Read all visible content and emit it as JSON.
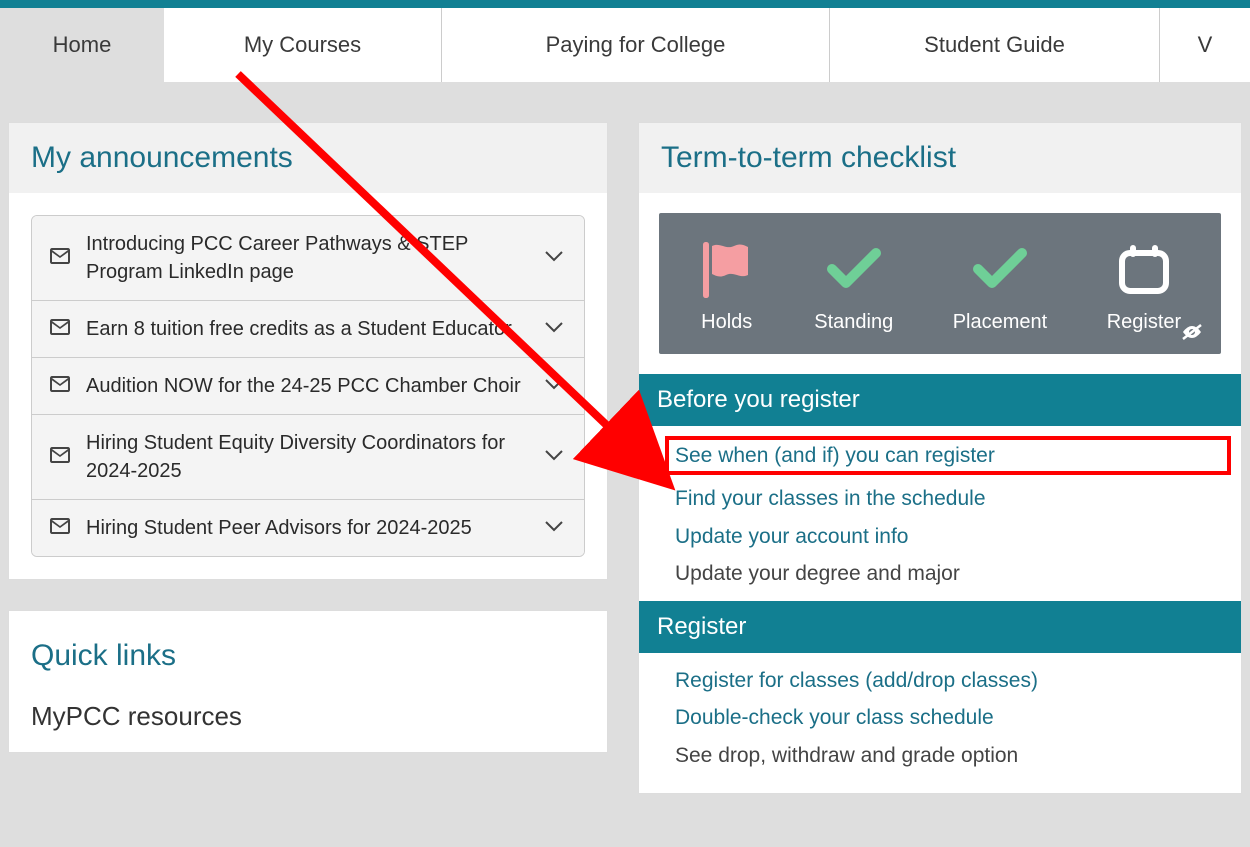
{
  "nav": {
    "home": "Home",
    "my_courses": "My Courses",
    "paying": "Paying for College",
    "guide": "Student Guide",
    "v": "V"
  },
  "announcements": {
    "title": "My announcements",
    "items": [
      "Introducing PCC Career Pathways & STEP Program LinkedIn page",
      "Earn 8 tuition free credits as a Student Educator",
      "Audition NOW for the 24-25 PCC Chamber Choir",
      "Hiring Student Equity Diversity Coordinators for 2024-2025",
      "Hiring Student Peer Advisors for 2024-2025"
    ]
  },
  "quicklinks": {
    "title": "Quick links",
    "sub": "MyPCC resources"
  },
  "checklist": {
    "title": "Term-to-term checklist",
    "status": {
      "holds": "Holds",
      "standing": "Standing",
      "placement": "Placement",
      "register": "Register"
    },
    "before": {
      "heading": "Before you register",
      "links": [
        "See when (and if) you can register",
        "Find your classes in the schedule",
        "Update your account info",
        "Update your degree and major"
      ]
    },
    "register": {
      "heading": "Register",
      "links": [
        "Register for classes (add/drop classes)",
        "Double-check your class schedule",
        "See drop, withdraw and grade option"
      ]
    }
  }
}
